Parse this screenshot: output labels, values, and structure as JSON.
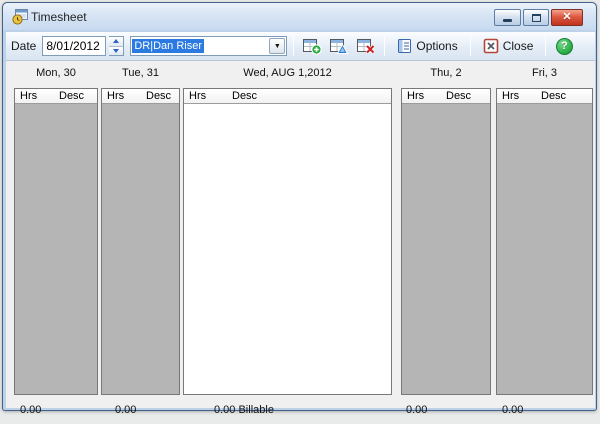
{
  "window": {
    "title": "Timesheet"
  },
  "toolbar": {
    "date_label": "Date",
    "date_value": "8/01/2012",
    "employee_value": "DR|Dan Riser",
    "options_label": "Options",
    "close_label": "Close"
  },
  "icons": {
    "title": "timesheet-clock",
    "add_entry": "grid-with-green-plus",
    "edit_entry": "grid-with-blue-triangle",
    "delete_entry": "grid-with-red-x",
    "options": "blue-notebook",
    "close": "red-x-box",
    "help": "?",
    "dropdown": "▼"
  },
  "grid": {
    "columns": [
      {
        "day_label": "Mon, 30",
        "hrs_header": "Hrs",
        "desc_header": "Desc",
        "total": "0.00"
      },
      {
        "day_label": "Tue, 31",
        "hrs_header": "Hrs",
        "desc_header": "Desc",
        "total": "0.00"
      },
      {
        "day_label": "Wed, AUG 1,2012",
        "hrs_header": "Hrs",
        "desc_header": "Desc",
        "total": "0.00 Billable"
      },
      {
        "day_label": "Thu, 2",
        "hrs_header": "Hrs",
        "desc_header": "Desc",
        "total": "0.00"
      },
      {
        "day_label": "Fri, 3",
        "hrs_header": "Hrs",
        "desc_header": "Desc",
        "total": "0.00"
      }
    ]
  },
  "colors": {
    "selection_blue": "#2a7ae2",
    "column_body_gray": "#b5b5b5",
    "close_caption_red": "#dd5941",
    "help_green": "#2eb44c",
    "titlebar_blue": "#d7e4f4"
  }
}
